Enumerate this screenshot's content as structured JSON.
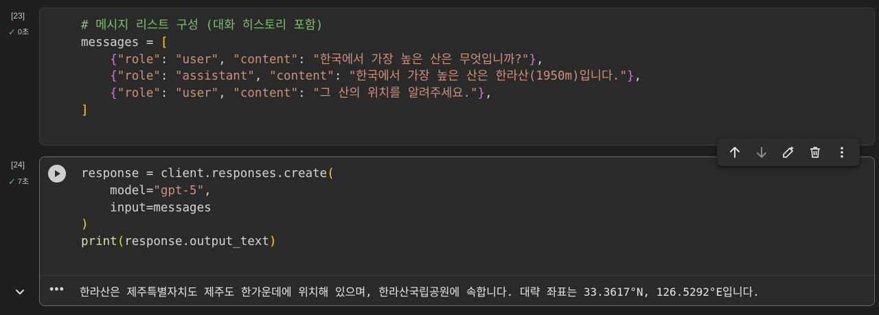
{
  "cell1": {
    "exec_count": "[23]",
    "status_check": "✓",
    "duration": "0초",
    "code": {
      "comment": "# 메시지 리스트 구성 (대화 히스토리 포함)",
      "messages_var": "messages = ",
      "open_bracket": "[",
      "close_bracket": "]",
      "role_key": "\"role\"",
      "content_key": "\"content\"",
      "rows": [
        {
          "role": "\"user\"",
          "content": "\"한국에서 가장 높은 산은 무엇입니까?\""
        },
        {
          "role": "\"assistant\"",
          "content": "\"한국에서 가장 높은 산은 한라산(1950m)입니다.\""
        },
        {
          "role": "\"user\"",
          "content": "\"그 산의 위치를 알려주세요.\""
        }
      ]
    }
  },
  "cell2": {
    "exec_count": "[24]",
    "status_check": "✓",
    "duration": "7초",
    "code": {
      "line1_prefix": "response = client.responses.create",
      "model_kw": "model=",
      "model_val": "\"gpt-5\"",
      "model_end": ",",
      "input_line": "input=messages",
      "print_fn": "print",
      "print_arg": "response.output_text"
    },
    "output": {
      "dots": "•••",
      "text": "한라산은 제주특별자치도 제주도 한가운데에 위치해 있으며, 한라산국립공원에 속합니다. 대략 좌표는 33.3617°N, 126.5292°E입니다."
    }
  },
  "toolbar": {
    "icons": [
      "arrow-up-icon",
      "arrow-down-icon",
      "edit-icon",
      "delete-icon",
      "more-icon"
    ]
  },
  "colors": {
    "background": "#1f1f1f",
    "cell_bg": "#2a2a2a",
    "comment": "#7fbf6f",
    "string": "#ce9178",
    "bracket_yellow": "#ffd700",
    "bracket_purple": "#da70d6",
    "check": "#5cc26b"
  }
}
